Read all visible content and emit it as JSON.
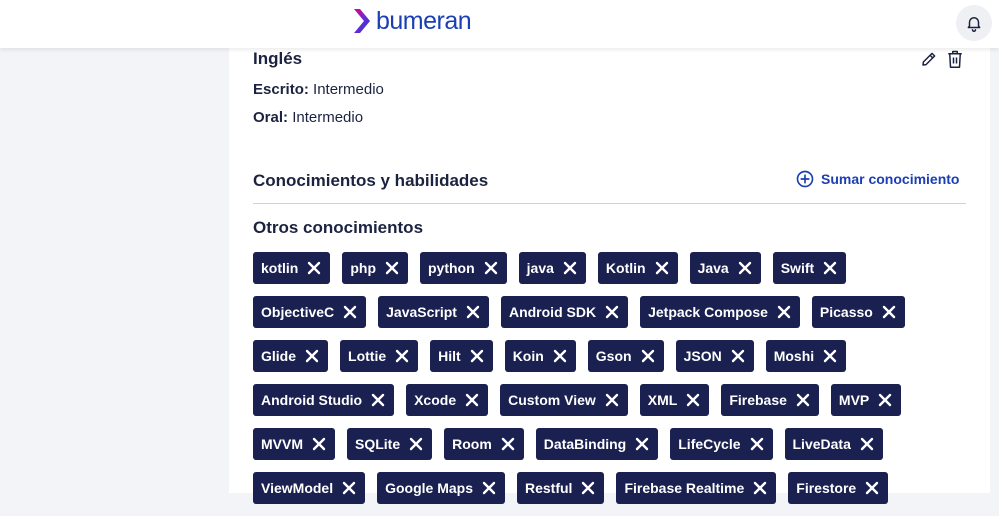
{
  "header": {
    "brand": "bumeran",
    "brand_color": "#1b3fb3",
    "notification_icon": "bell-icon"
  },
  "language": {
    "title": "Inglés",
    "written_label": "Escrito:",
    "written_value": "Intermedio",
    "oral_label": "Oral:",
    "oral_value": "Intermedio",
    "edit_icon": "pencil-icon",
    "delete_icon": "trash-icon"
  },
  "skills": {
    "title": "Conocimientos y habilidades",
    "add_label": "Sumar conocimiento",
    "other_title": "Otros conocimientos",
    "chip_color": "#1a2150",
    "rows": [
      [
        "kotlin",
        "php",
        "python",
        "java",
        "Kotlin",
        "Java",
        "Swift"
      ],
      [
        "ObjectiveC",
        "JavaScript",
        "Android SDK",
        "Jetpack Compose",
        "Picasso"
      ],
      [
        "Glide",
        "Lottie",
        "Hilt",
        "Koin",
        "Gson",
        "JSON",
        "Moshi"
      ],
      [
        "Android Studio",
        "Xcode",
        "Custom View",
        "XML",
        "Firebase",
        "MVP"
      ],
      [
        "MVVM",
        "SQLite",
        "Room",
        "DataBinding",
        "LifeCycle",
        "LiveData"
      ],
      [
        "ViewModel",
        "Google Maps",
        "Restful",
        "Firebase Realtime",
        "Firestore"
      ]
    ]
  }
}
